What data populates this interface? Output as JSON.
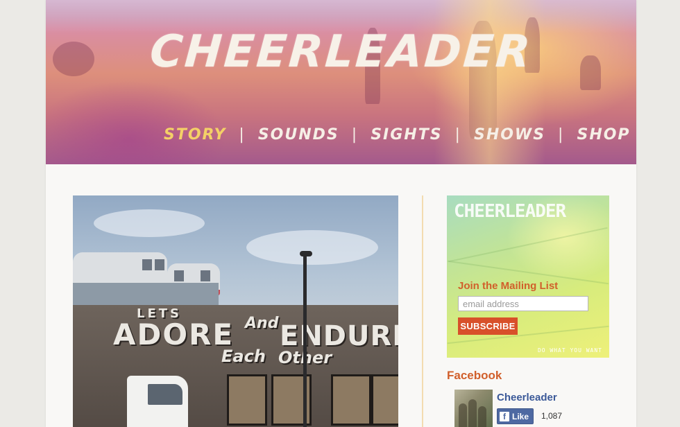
{
  "header": {
    "logo": "CHEERLEADER",
    "nav": [
      {
        "label": "Story",
        "active": true
      },
      {
        "label": "Sounds",
        "active": false
      },
      {
        "label": "Sights",
        "active": false
      },
      {
        "label": "Shows",
        "active": false
      },
      {
        "label": "Shop",
        "active": false
      }
    ],
    "separator": "|"
  },
  "post": {
    "mural": {
      "line1": "LETS",
      "line2": "ADORE",
      "line3": "And",
      "line4": "ENDURE",
      "line5": "Each",
      "line6": "Other"
    }
  },
  "sidebar": {
    "mailing": {
      "brand": "CHEERLEADER",
      "heading": "Join the Mailing List",
      "email_placeholder": "email address",
      "subscribe_label": "SUBSCRIBE",
      "tagline": "DO WHAT YOU WANT"
    },
    "facebook": {
      "heading": "Facebook",
      "page_name": "Cheerleader",
      "like_label": "Like",
      "like_icon": "f",
      "like_count": "1,087"
    }
  },
  "colors": {
    "accent_orange": "#d15f2b",
    "nav_active": "#f4d067",
    "facebook_blue": "#3b5998"
  }
}
